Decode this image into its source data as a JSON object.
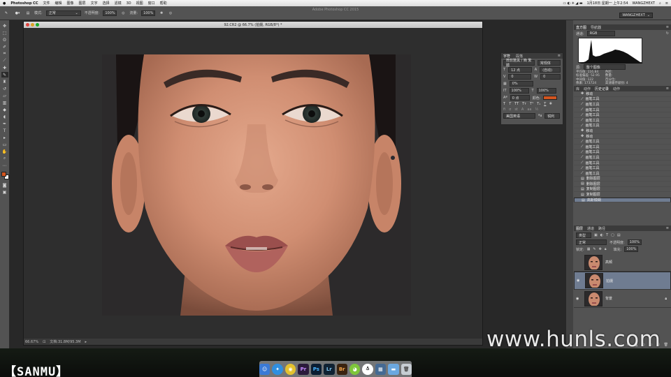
{
  "menubar": {
    "app": "Photoshop CC",
    "items": [
      "文件",
      "编辑",
      "图像",
      "图层",
      "文字",
      "选择",
      "滤镜",
      "3D",
      "视图",
      "窗口",
      "帮助"
    ],
    "datetime": "1月18日 星期一 上午2:54",
    "user": "WANGZHEXT"
  },
  "window_title": "Adobe Photoshop CC 2015",
  "options": {
    "mode_label": "模式:",
    "mode_value": "正常",
    "opacity_label": "不透明度:",
    "opacity_value": "100%",
    "flow_label": "流量:",
    "flow_value": "100%",
    "workspace": "WANGZHEXT"
  },
  "document": {
    "tab_title": "92.CR2 @ 66.7% (拍摄, RGB/8*) *",
    "zoom": "66.67%",
    "doc_info": "文档:31.8M/95.3M"
  },
  "character_panel": {
    "tabs": [
      "字符",
      "段落"
    ],
    "font_family": "微软雅黑 / 簡 繁體",
    "font_style": "常规体",
    "size": "12 点",
    "leading": "(自动)",
    "kerning": "0",
    "tracking": "0",
    "baseline": "0 点",
    "scale_v": "100%",
    "scale_h": "100%",
    "tsume": "0%",
    "color_label": "颜色:",
    "language": "美国英语",
    "antialias": "锐利"
  },
  "histogram_panel": {
    "tabs": [
      "直方图",
      "导航器"
    ],
    "channel_label": "通道:",
    "channel": "RGB",
    "source_label": "源:",
    "source": "整个图像",
    "stats_left": [
      "平均值: 116.84",
      "标准偏差: 52.95",
      "中间值: 122",
      "像素: 173724"
    ],
    "stats_right": [
      "色阶:",
      "数量:",
      "百分位:",
      "高速缓存级别: 4"
    ]
  },
  "history_panel": {
    "tabs": [
      "库",
      "动作",
      "历史记录",
      "动作"
    ],
    "items": [
      {
        "icon": "move",
        "label": "移动"
      },
      {
        "icon": "brush",
        "label": "画笔工具"
      },
      {
        "icon": "brush",
        "label": "画笔工具"
      },
      {
        "icon": "brush",
        "label": "画笔工具"
      },
      {
        "icon": "brush",
        "label": "画笔工具"
      },
      {
        "icon": "brush",
        "label": "画笔工具"
      },
      {
        "icon": "brush",
        "label": "画笔工具"
      },
      {
        "icon": "move",
        "label": "移动"
      },
      {
        "icon": "move",
        "label": "移动"
      },
      {
        "icon": "brush",
        "label": "画笔工具"
      },
      {
        "icon": "brush",
        "label": "画笔工具"
      },
      {
        "icon": "brush",
        "label": "画笔工具"
      },
      {
        "icon": "brush",
        "label": "画笔工具"
      },
      {
        "icon": "brush",
        "label": "画笔工具"
      },
      {
        "icon": "brush",
        "label": "画笔工具"
      },
      {
        "icon": "brush",
        "label": "画笔工具"
      },
      {
        "icon": "layer",
        "label": "删除图层"
      },
      {
        "icon": "layer",
        "label": "删除图层"
      },
      {
        "icon": "layer",
        "label": "复制图层"
      },
      {
        "icon": "layer",
        "label": "复制图层"
      },
      {
        "icon": "layer",
        "label": "高斯模糊"
      }
    ],
    "selected_index": 20
  },
  "layers_panel": {
    "tabs": [
      "图层",
      "通道",
      "路径"
    ],
    "kind": "类型",
    "blend": "正常",
    "opacity_label": "不透明度:",
    "opacity": "100%",
    "lock_label": "锁定:",
    "fill_label": "填充:",
    "fill": "100%",
    "layers": [
      {
        "name": "高频",
        "visible": false,
        "locked": false
      },
      {
        "name": "拍摄",
        "visible": true,
        "locked": false,
        "selected": true
      },
      {
        "name": "背景",
        "visible": true,
        "locked": true
      }
    ]
  },
  "overlay": {
    "brand": "【SANMU】",
    "watermark": "www.hunls.com"
  },
  "dock_apps": [
    "finder",
    "safari",
    "chrome",
    "premiere",
    "photoshop",
    "lightroom",
    "bridge",
    "android",
    "qq",
    "photo",
    "folder",
    "trash"
  ],
  "colors": {
    "ui_bg": "#535353",
    "foreground_color": "#d2551f",
    "background_color": "#ffffff",
    "selection": "#6f7c91"
  }
}
